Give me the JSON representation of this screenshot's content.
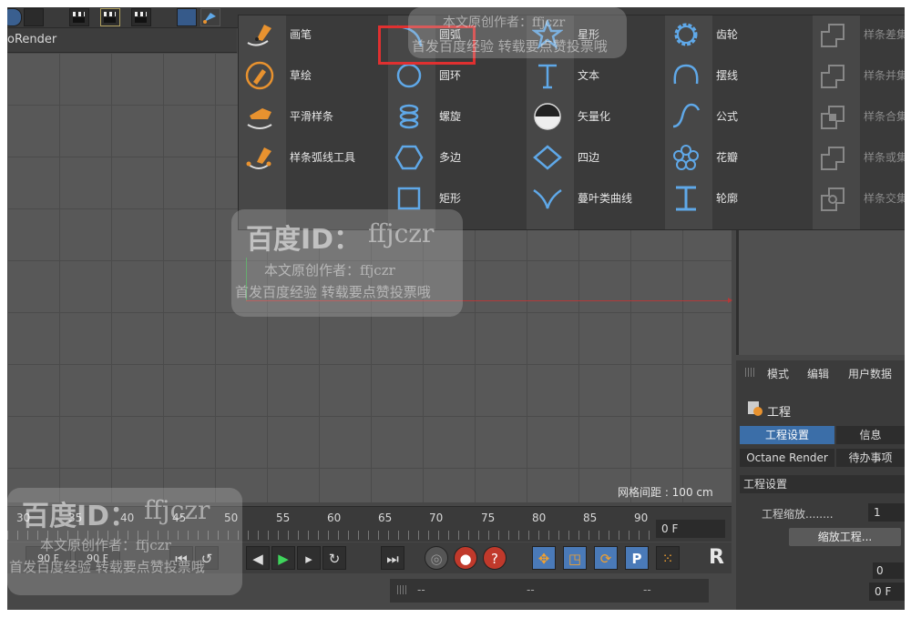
{
  "viewport": {
    "title": "oRender",
    "grid_spacing_label": "网格间距 : 100 cm"
  },
  "spline_menu": {
    "columns": [
      [
        {
          "label": "画笔",
          "icon": "pen-icon"
        },
        {
          "label": "草绘",
          "icon": "sketch-icon"
        },
        {
          "label": "平滑样条",
          "icon": "smooth-spline-icon"
        },
        {
          "label": "样条弧线工具",
          "icon": "spline-arc-tool-icon"
        }
      ],
      [
        {
          "label": "圆弧",
          "icon": "arc-icon"
        },
        {
          "label": "圆环",
          "icon": "circle-icon"
        },
        {
          "label": "螺旋",
          "icon": "helix-icon"
        },
        {
          "label": "多边",
          "icon": "hexagon-icon"
        },
        {
          "label": "矩形",
          "icon": "rectangle-icon"
        }
      ],
      [
        {
          "label": "星形",
          "icon": "star-icon"
        },
        {
          "label": "文本",
          "icon": "text-icon"
        },
        {
          "label": "矢量化",
          "icon": "vectorizer-icon"
        },
        {
          "label": "四边",
          "icon": "diamond-icon"
        },
        {
          "label": "蔓叶类曲线",
          "icon": "cissoid-icon"
        }
      ],
      [
        {
          "label": "齿轮",
          "icon": "gear-icon"
        },
        {
          "label": "摆线",
          "icon": "cycloid-icon"
        },
        {
          "label": "公式",
          "icon": "formula-icon"
        },
        {
          "label": "花瓣",
          "icon": "flower-icon"
        },
        {
          "label": "轮廓",
          "icon": "profile-icon"
        }
      ],
      [
        {
          "label": "样条差集",
          "icon": "spline-subtract-icon"
        },
        {
          "label": "样条并集",
          "icon": "spline-union-icon"
        },
        {
          "label": "样条合集",
          "icon": "spline-and-icon"
        },
        {
          "label": "样条或集",
          "icon": "spline-or-icon"
        },
        {
          "label": "样条交集",
          "icon": "spline-intersect-icon"
        }
      ]
    ]
  },
  "attributes": {
    "menu": [
      "模式",
      "编辑",
      "用户数据"
    ],
    "object_title": "工程",
    "tabs_row1": [
      "工程设置",
      "信息"
    ],
    "tabs_row2": [
      "Octane Render",
      "待办事项"
    ],
    "section": "工程设置",
    "scale_label": "工程缩放........",
    "scale_value": "1",
    "scale_button": "缩放工程...",
    "value_0": "0",
    "value_f": "0 F"
  },
  "timeline": {
    "ticks": [
      "30",
      "35",
      "40",
      "45",
      "50",
      "55",
      "60",
      "65",
      "70",
      "75",
      "80",
      "85",
      "90"
    ],
    "frame_value": "0 F",
    "left_fields": [
      "90 F",
      "90 F"
    ]
  },
  "statusbar": {
    "dashes": [
      "--",
      "--",
      "--"
    ]
  },
  "watermarks": {
    "brand": "百度ID：",
    "user": "ffjczr",
    "line1": "本文原创作者：ffjczr",
    "line2": "首发百度经验 转载要点赞投票哦",
    "top_line1": "本文原创作者：ffjczr",
    "top_line2": "首发百度经验 转载要点赞投票哦"
  },
  "colors": {
    "accent_orange": "#e8922f",
    "icon_blue": "#5fa8e8",
    "highlight_red": "#e03030",
    "active_tab_blue": "#3b6ea8"
  }
}
